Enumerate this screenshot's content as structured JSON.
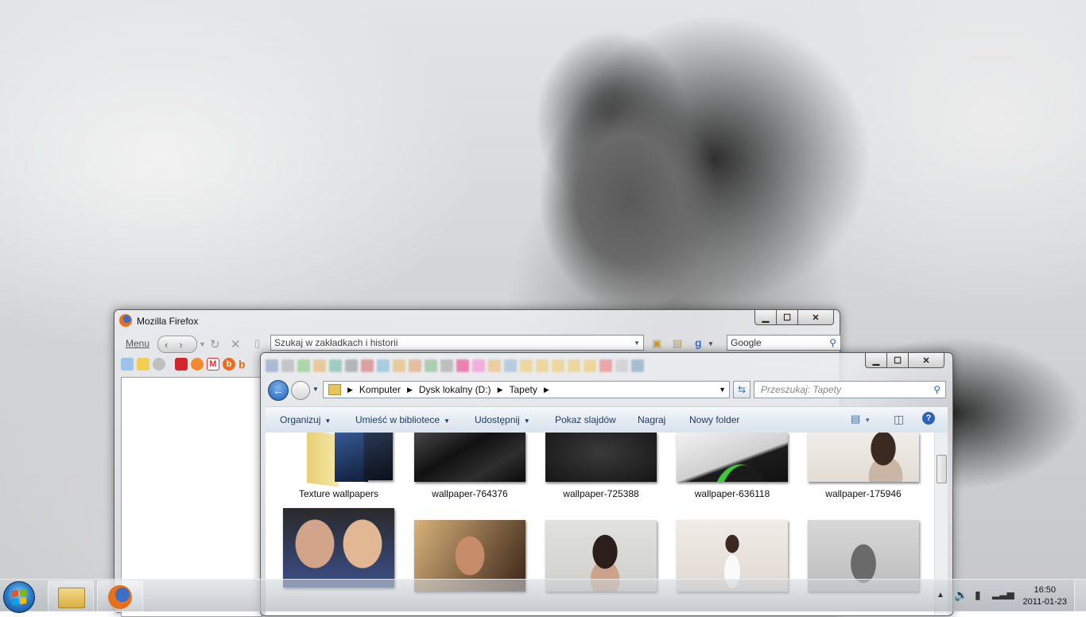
{
  "firefox": {
    "title": "Mozilla Firefox",
    "menu_label": "Menu",
    "url_placeholder": "Szukaj w zakładkach i historii",
    "search_engine": "Google",
    "icons": [
      "back-arrow-icon",
      "forward-arrow-icon",
      "reload-icon",
      "stop-icon",
      "page-icon",
      "clipboard-icon",
      "bookmark-star-icon",
      "google-icon",
      "search-icon"
    ],
    "bookmark_icons": [
      "bookmarks-search-icon",
      "folder-icon",
      "gray-circle-icon",
      "red-flower-icon",
      "balloon-icon",
      "gmail-icon",
      "orange-b-icon",
      "blogger-icon"
    ]
  },
  "explorer": {
    "breadcrumb": [
      "Komputer",
      "Dysk lokalny (D:)",
      "Tapety"
    ],
    "search_placeholder": "Przeszukaj: Tapety",
    "commands": {
      "organize": "Organizuj",
      "add_to_library": "Umieść w bibliotece",
      "share": "Udostępnij",
      "slideshow": "Pokaz slajdów",
      "burn": "Nagraj",
      "new_folder": "Nowy folder"
    },
    "files": [
      {
        "name": "Texture wallpapers",
        "type": "folder"
      },
      {
        "name": "wallpaper-764376",
        "type": "image"
      },
      {
        "name": "wallpaper-725388",
        "type": "image"
      },
      {
        "name": "wallpaper-636118",
        "type": "image"
      },
      {
        "name": "wallpaper-175946",
        "type": "image"
      }
    ],
    "thumb_colors": {
      "folder_back": "#e3c76a",
      "dark": "#1c1c1c",
      "charcoal": "#2a2a2a",
      "green_accent": "#3fc93f",
      "portrait_light": "#e6e1da"
    }
  },
  "taskbar": {
    "time": "16:50",
    "date": "2011-01-23",
    "colors": {
      "start_orb": "#2d7cc9",
      "flag_red": "#f25022",
      "flag_green": "#7fba00",
      "flag_blue": "#00a4ef",
      "flag_yellow": "#ffb900"
    }
  }
}
